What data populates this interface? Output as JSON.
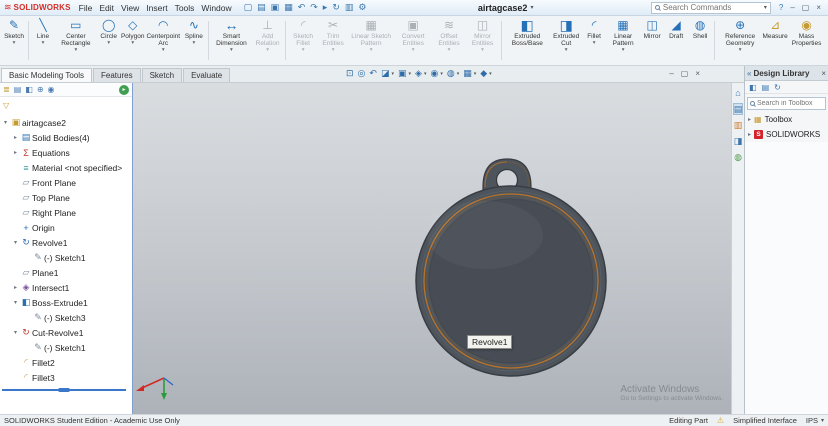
{
  "titlebar": {
    "logo_mark": "≋",
    "logo_text": "SOLIDWORKS",
    "menus": [
      "File",
      "Edit",
      "View",
      "Insert",
      "Tools",
      "Window"
    ],
    "quick_icons": [
      {
        "name": "new-icon",
        "glyph": "▢"
      },
      {
        "name": "open-icon",
        "glyph": "▤"
      },
      {
        "name": "save-icon",
        "glyph": "▣"
      },
      {
        "name": "print-icon",
        "glyph": "▦"
      },
      {
        "name": "undo-icon",
        "glyph": "↶"
      },
      {
        "name": "redo-icon",
        "glyph": "↷"
      },
      {
        "name": "select-icon",
        "glyph": "▸"
      },
      {
        "name": "rebuild-icon",
        "glyph": "↻"
      },
      {
        "name": "file-properties-icon",
        "glyph": "▥"
      },
      {
        "name": "options-icon",
        "glyph": "⚙"
      }
    ],
    "doc_name": "airtagcase2",
    "doc_caret": "▾",
    "search": {
      "placeholder": "Search Commands",
      "caret": "▾"
    },
    "help": "?",
    "window_controls": {
      "minimize": "–",
      "restore": "▢",
      "close": "×"
    }
  },
  "ribbon": {
    "buttons": [
      {
        "label": "Sketch",
        "glyph": "✎",
        "caret": "▾"
      },
      {
        "label": "Line",
        "glyph": "╲",
        "caret": "▾"
      },
      {
        "label": "Center Rectangle",
        "glyph": "▭",
        "caret": "▾"
      },
      {
        "label": "Circle",
        "glyph": "◯",
        "caret": "▾"
      },
      {
        "label": "Polygon",
        "glyph": "◇",
        "caret": "▾"
      },
      {
        "label": "Centerpoint Arc",
        "glyph": "◠",
        "caret": "▾"
      },
      {
        "label": "Spline",
        "glyph": "∿",
        "caret": "▾"
      },
      {
        "label": "Smart Dimension",
        "glyph": "↔",
        "caret": "▾"
      },
      {
        "label": "Add Relation",
        "glyph": "⊥",
        "caret": "▾"
      },
      {
        "label": "Sketch Fillet",
        "glyph": "◜",
        "caret": "▾"
      },
      {
        "label": "Trim Entities",
        "glyph": "✂",
        "caret": "▾"
      },
      {
        "label": "Linear Sketch Pattern",
        "glyph": "▦",
        "caret": "▾"
      },
      {
        "label": "Convert Entities",
        "glyph": "▣",
        "caret": "▾"
      },
      {
        "label": "Offset Entities",
        "glyph": "≋",
        "caret": "▾"
      },
      {
        "label": "Mirror Entities",
        "glyph": "◫",
        "caret": "▾"
      },
      {
        "label": "Extruded Boss/Base",
        "glyph": "◧"
      },
      {
        "label": "Extruded Cut",
        "glyph": "◨",
        "caret": "▾"
      },
      {
        "label": "Fillet",
        "glyph": "◜",
        "caret": "▾"
      },
      {
        "label": "Linear Pattern",
        "glyph": "▦",
        "caret": "▾"
      },
      {
        "label": "Mirror",
        "glyph": "◫"
      },
      {
        "label": "Draft",
        "glyph": "◢"
      },
      {
        "label": "Shell",
        "glyph": "◍"
      },
      {
        "label": "Reference Geometry",
        "glyph": "⊕",
        "caret": "▾"
      },
      {
        "label": "Measure",
        "glyph": "⊿"
      },
      {
        "label": "Mass Properties",
        "glyph": "◉"
      }
    ]
  },
  "tabs": [
    {
      "label": "Basic Modeling Tools"
    },
    {
      "label": "Features"
    },
    {
      "label": "Sketch"
    },
    {
      "label": "Evaluate"
    }
  ],
  "headsup": {
    "icons": [
      {
        "name": "zoom-to-fit-icon",
        "glyph": "⊡"
      },
      {
        "name": "zoom-to-area-icon",
        "glyph": "◎"
      },
      {
        "name": "previous-view-icon",
        "glyph": "↶"
      },
      {
        "name": "section-view-icon",
        "glyph": "◪",
        "caret": "▾"
      },
      {
        "name": "view-orientation-icon",
        "glyph": "▣",
        "caret": "▾"
      },
      {
        "name": "display-style-icon",
        "glyph": "◈",
        "caret": "▾"
      },
      {
        "name": "hide-show-items-icon",
        "glyph": "◉",
        "caret": "▾"
      },
      {
        "name": "edit-appearance-icon",
        "glyph": "◍",
        "caret": "▾"
      },
      {
        "name": "apply-scene-icon",
        "glyph": "▦",
        "caret": "▾"
      },
      {
        "name": "view-settings-icon",
        "glyph": "◆",
        "caret": "▾"
      }
    ]
  },
  "doc_window_controls": {
    "minimize": "–",
    "restore": "▢",
    "close": "×"
  },
  "tree_panel": {
    "tabs": [
      {
        "name": "featuremanager-tab-icon",
        "glyph": "≣"
      },
      {
        "name": "propertymanager-tab-icon",
        "glyph": "▤"
      },
      {
        "name": "configurationmanager-tab-icon",
        "glyph": "◧"
      },
      {
        "name": "dimxpertmanager-tab-icon",
        "glyph": "⊕"
      },
      {
        "name": "displaymanager-tab-icon",
        "glyph": "◉"
      }
    ],
    "expand_icon": "▸",
    "filter_icon": "▽",
    "items": [
      {
        "arrow": "▾",
        "glyph": "▣",
        "label": "airtagcase2"
      },
      {
        "arrow": "▸",
        "glyph": "▤",
        "label": "Solid Bodies(4)"
      },
      {
        "arrow": "▸",
        "glyph": "Σ",
        "label": "Equations"
      },
      {
        "arrow": "",
        "glyph": "≡",
        "label": "Material <not specified>"
      },
      {
        "arrow": "",
        "glyph": "▱",
        "label": "Front Plane"
      },
      {
        "arrow": "",
        "glyph": "▱",
        "label": "Top Plane"
      },
      {
        "arrow": "",
        "glyph": "▱",
        "label": "Right Plane"
      },
      {
        "arrow": "",
        "glyph": "+",
        "label": "Origin"
      },
      {
        "arrow": "▾",
        "glyph": "↻",
        "label": "Revolve1"
      },
      {
        "arrow": "",
        "glyph": "✎",
        "label": "(-) Sketch1"
      },
      {
        "arrow": "",
        "glyph": "▱",
        "label": "Plane1"
      },
      {
        "arrow": "▸",
        "glyph": "◈",
        "label": "Intersect1"
      },
      {
        "arrow": "▾",
        "glyph": "◧",
        "label": "Boss-Extrude1"
      },
      {
        "arrow": "",
        "glyph": "✎",
        "label": "(-) Sketch3"
      },
      {
        "arrow": "▾",
        "glyph": "↻",
        "label": "Cut-Revolve1"
      },
      {
        "arrow": "",
        "glyph": "✎",
        "label": "(-) Sketch1"
      },
      {
        "arrow": "",
        "glyph": "◜",
        "label": "Fillet2"
      },
      {
        "arrow": "",
        "glyph": "◜",
        "label": "Fillet3"
      }
    ]
  },
  "viewport": {
    "tooltip": "Revolve1",
    "model_colors": {
      "body": "#4e545c",
      "edge": "#383d44",
      "accent": "#b8742a",
      "inner": "#474c53",
      "hole": "#cfd2d6"
    },
    "triad_colors": {
      "x": "#d22a23",
      "y": "#2a9c3e",
      "z": "#2a62c9"
    }
  },
  "watermark": {
    "line1": "Activate Windows",
    "line2": "Go to Settings to activate Windows."
  },
  "task_strip": {
    "icons": [
      {
        "name": "solidworks-resources-icon",
        "glyph": "⌂"
      },
      {
        "name": "design-library-icon",
        "glyph": "▤"
      },
      {
        "name": "file-explorer-icon",
        "glyph": "▥"
      },
      {
        "name": "view-palette-icon",
        "glyph": "◨"
      },
      {
        "name": "appearances-scenes-icon",
        "glyph": "◍"
      }
    ]
  },
  "design_library": {
    "collapse_icon": "«",
    "title": "Design Library",
    "close_icon": "×",
    "toolbar": [
      {
        "name": "add-to-library-icon",
        "glyph": "◧"
      },
      {
        "name": "add-file-location-icon",
        "glyph": "▤"
      },
      {
        "name": "refresh-icon",
        "glyph": "↻"
      }
    ],
    "search_placeholder": "Search in Toolbox",
    "items": [
      {
        "arrow": "▸",
        "glyph": "▦",
        "label": "Toolbox"
      },
      {
        "arrow": "▸",
        "glyph": "S",
        "label": "SOLIDWORKS"
      }
    ]
  },
  "statusbar": {
    "left": "SOLIDWORKS Student Edition - Academic Use Only",
    "editing": "Editing Part",
    "warn_icon": "⚠",
    "interface": "Simplified Interface",
    "units": "IPS",
    "units_caret": "▾"
  }
}
